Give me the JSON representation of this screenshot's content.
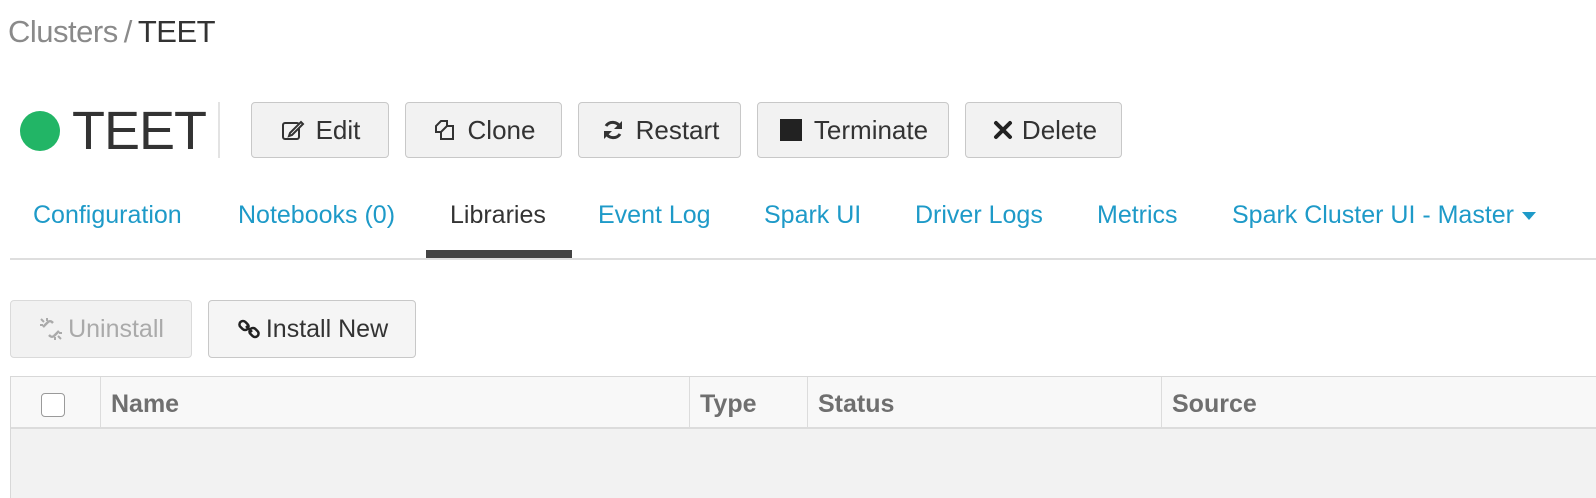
{
  "breadcrumb": {
    "root": "Clusters",
    "separator": "/",
    "current": "TEET"
  },
  "cluster": {
    "name": "TEET",
    "status_color": "#22b566"
  },
  "actions": {
    "edit": "Edit",
    "clone": "Clone",
    "restart": "Restart",
    "terminate": "Terminate",
    "delete": "Delete"
  },
  "tabs": [
    {
      "label": "Configuration"
    },
    {
      "label": "Notebooks (0)"
    },
    {
      "label": "Libraries"
    },
    {
      "label": "Event Log"
    },
    {
      "label": "Spark UI"
    },
    {
      "label": "Driver Logs"
    },
    {
      "label": "Metrics"
    },
    {
      "label": "Spark Cluster UI - Master"
    }
  ],
  "active_tab": "Libraries",
  "library_actions": {
    "uninstall": "Uninstall",
    "install_new": "Install New"
  },
  "table": {
    "columns": [
      "Name",
      "Type",
      "Status",
      "Source"
    ],
    "rows": []
  },
  "colors": {
    "link": "#1e9ac8",
    "active_tab_underline": "#444444",
    "disabled_text": "#aaaaaa"
  }
}
